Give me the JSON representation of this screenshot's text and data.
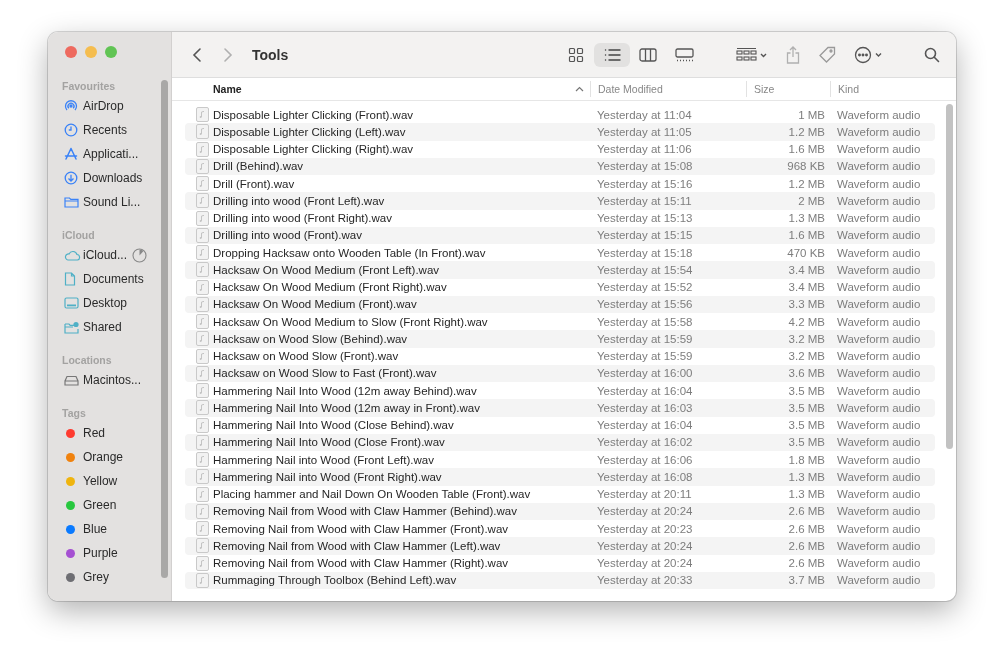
{
  "window": {
    "title": "Tools"
  },
  "sidebar": {
    "sections": [
      {
        "heading": "Favourites",
        "items": [
          {
            "label": "AirDrop"
          },
          {
            "label": "Recents"
          },
          {
            "label": "Applicati..."
          },
          {
            "label": "Downloads"
          },
          {
            "label": "Sound Li..."
          }
        ]
      },
      {
        "heading": "iCloud",
        "items": [
          {
            "label": "iCloud..."
          },
          {
            "label": "Documents"
          },
          {
            "label": "Desktop"
          },
          {
            "label": "Shared"
          }
        ]
      },
      {
        "heading": "Locations",
        "items": [
          {
            "label": "Macintos..."
          }
        ]
      },
      {
        "heading": "Tags",
        "items": [
          {
            "label": "Red",
            "color": "#fe3b30"
          },
          {
            "label": "Orange",
            "color": "#f0820e"
          },
          {
            "label": "Yellow",
            "color": "#efb40e"
          },
          {
            "label": "Green",
            "color": "#28c73f"
          },
          {
            "label": "Blue",
            "color": "#0a7aff"
          },
          {
            "label": "Purple",
            "color": "#a550d2"
          },
          {
            "label": "Grey",
            "color": "#6e6e73"
          }
        ]
      }
    ]
  },
  "toolbar": {
    "view_modes": [
      {
        "selected": false
      },
      {
        "selected": true
      },
      {
        "selected": false
      },
      {
        "selected": false
      }
    ]
  },
  "table": {
    "columns": [
      {
        "label": "Name",
        "sorted": true
      },
      {
        "label": "Date Modified",
        "sorted": false
      },
      {
        "label": "Size",
        "sorted": false
      },
      {
        "label": "Kind",
        "sorted": false
      }
    ],
    "rows": [
      {
        "name": "Disposable Lighter Clicking (Front).wav",
        "date": "Yesterday at 11:04",
        "size": "1 MB",
        "kind": "Waveform audio"
      },
      {
        "name": "Disposable Lighter Clicking (Left).wav",
        "date": "Yesterday at 11:05",
        "size": "1.2 MB",
        "kind": "Waveform audio"
      },
      {
        "name": "Disposable Lighter Clicking (Right).wav",
        "date": "Yesterday at 11:06",
        "size": "1.6 MB",
        "kind": "Waveform audio"
      },
      {
        "name": "Drill (Behind).wav",
        "date": "Yesterday at 15:08",
        "size": "968 KB",
        "kind": "Waveform audio"
      },
      {
        "name": "Drill (Front).wav",
        "date": "Yesterday at 15:16",
        "size": "1.2 MB",
        "kind": "Waveform audio"
      },
      {
        "name": "Drilling into wood (Front Left).wav",
        "date": "Yesterday at 15:11",
        "size": "2 MB",
        "kind": "Waveform audio"
      },
      {
        "name": "Drilling into wood (Front Right).wav",
        "date": "Yesterday at 15:13",
        "size": "1.3 MB",
        "kind": "Waveform audio"
      },
      {
        "name": "Drilling into wood (Front).wav",
        "date": "Yesterday at 15:15",
        "size": "1.6 MB",
        "kind": "Waveform audio"
      },
      {
        "name": "Dropping Hacksaw onto Wooden Table (In Front).wav",
        "date": "Yesterday at 15:18",
        "size": "470 KB",
        "kind": "Waveform audio"
      },
      {
        "name": "Hacksaw On Wood Medium (Front Left).wav",
        "date": "Yesterday at 15:54",
        "size": "3.4 MB",
        "kind": "Waveform audio"
      },
      {
        "name": "Hacksaw On Wood Medium (Front Right).wav",
        "date": "Yesterday at 15:52",
        "size": "3.4 MB",
        "kind": "Waveform audio"
      },
      {
        "name": "Hacksaw On Wood Medium (Front).wav",
        "date": "Yesterday at 15:56",
        "size": "3.3 MB",
        "kind": "Waveform audio"
      },
      {
        "name": "Hacksaw On Wood Medium to Slow (Front Right).wav",
        "date": "Yesterday at 15:58",
        "size": "4.2 MB",
        "kind": "Waveform audio"
      },
      {
        "name": "Hacksaw on Wood Slow (Behind).wav",
        "date": "Yesterday at 15:59",
        "size": "3.2 MB",
        "kind": "Waveform audio"
      },
      {
        "name": "Hacksaw on Wood Slow (Front).wav",
        "date": "Yesterday at 15:59",
        "size": "3.2 MB",
        "kind": "Waveform audio"
      },
      {
        "name": "Hacksaw on Wood Slow to Fast (Front).wav",
        "date": "Yesterday at 16:00",
        "size": "3.6 MB",
        "kind": "Waveform audio"
      },
      {
        "name": "Hammering Nail Into Wood (12m away Behind).wav",
        "date": "Yesterday at 16:04",
        "size": "3.5 MB",
        "kind": "Waveform audio"
      },
      {
        "name": "Hammering Nail Into Wood (12m away in Front).wav",
        "date": "Yesterday at 16:03",
        "size": "3.5 MB",
        "kind": "Waveform audio"
      },
      {
        "name": "Hammering Nail Into Wood (Close Behind).wav",
        "date": "Yesterday at 16:04",
        "size": "3.5 MB",
        "kind": "Waveform audio"
      },
      {
        "name": "Hammering Nail Into Wood (Close Front).wav",
        "date": "Yesterday at 16:02",
        "size": "3.5 MB",
        "kind": "Waveform audio"
      },
      {
        "name": "Hammering Nail into Wood (Front Left).wav",
        "date": "Yesterday at 16:06",
        "size": "1.8 MB",
        "kind": "Waveform audio"
      },
      {
        "name": "Hammering Nail into Wood (Front Right).wav",
        "date": "Yesterday at 16:08",
        "size": "1.3 MB",
        "kind": "Waveform audio"
      },
      {
        "name": "Placing hammer and Nail Down On Wooden Table (Front).wav",
        "date": "Yesterday at 20:11",
        "size": "1.3 MB",
        "kind": "Waveform audio"
      },
      {
        "name": "Removing Nail from Wood with Claw Hammer (Behind).wav",
        "date": "Yesterday at 20:24",
        "size": "2.6 MB",
        "kind": "Waveform audio"
      },
      {
        "name": "Removing Nail from Wood with Claw Hammer (Front).wav",
        "date": "Yesterday at 20:23",
        "size": "2.6 MB",
        "kind": "Waveform audio"
      },
      {
        "name": "Removing Nail from Wood with Claw Hammer (Left).wav",
        "date": "Yesterday at 20:24",
        "size": "2.6 MB",
        "kind": "Waveform audio"
      },
      {
        "name": "Removing Nail from Wood with Claw Hammer (Right).wav",
        "date": "Yesterday at 20:24",
        "size": "2.6 MB",
        "kind": "Waveform audio"
      },
      {
        "name": "Rummaging Through Toolbox (Behind Left).wav",
        "date": "Yesterday at 20:33",
        "size": "3.7 MB",
        "kind": "Waveform audio"
      }
    ]
  }
}
